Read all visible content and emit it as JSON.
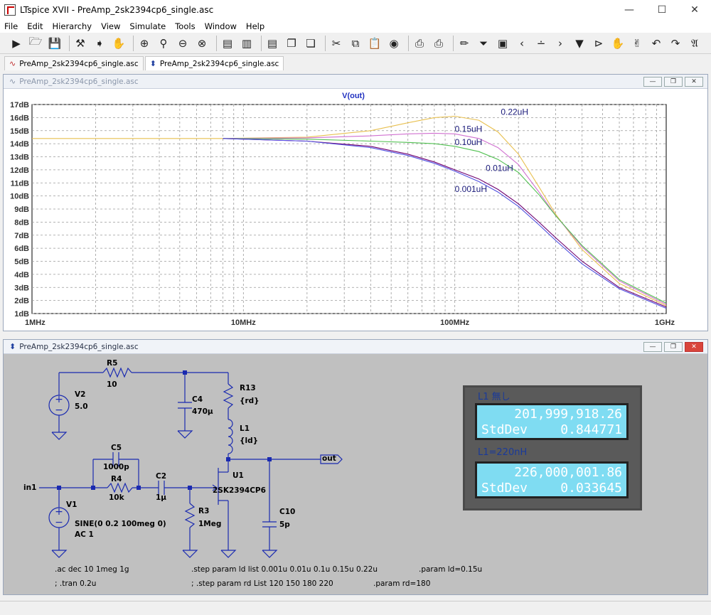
{
  "window": {
    "title": "LTspice XVII - PreAmp_2sk2394cp6_single.asc"
  },
  "menu": [
    "File",
    "Edit",
    "Hierarchy",
    "View",
    "Simulate",
    "Tools",
    "Window",
    "Help"
  ],
  "tabs": [
    {
      "label": "PreAmp_2sk2394cp6_single.asc",
      "icon": "waveform-icon"
    },
    {
      "label": "PreAmp_2sk2394cp6_single.asc",
      "icon": "schematic-icon"
    }
  ],
  "wave_window": {
    "title": "PreAmp_2sk2394cp6_single.asc"
  },
  "schematic_window": {
    "title": "PreAmp_2sk2394cp6_single.asc"
  },
  "chart_data": {
    "type": "line",
    "title": "V(out)",
    "x_scale": "log",
    "xlim": [
      1000000,
      1000000000
    ],
    "x_ticks": [
      "1MHz",
      "10MHz",
      "100MHz",
      "1GHz"
    ],
    "ylim": [
      1,
      17
    ],
    "y_ticks": [
      "1dB",
      "2dB",
      "3dB",
      "4dB",
      "5dB",
      "6dB",
      "7dB",
      "8dB",
      "9dB",
      "10dB",
      "11dB",
      "12dB",
      "13dB",
      "14dB",
      "15dB",
      "16dB",
      "17dB"
    ],
    "grid": true,
    "x": [
      1000000.0,
      8000000.0,
      20000000.0,
      40000000.0,
      60000000.0,
      80000000.0,
      100000000.0,
      130000000.0,
      160000000.0,
      200000000.0,
      250000000.0,
      300000000.0,
      400000000.0,
      600000000.0,
      1000000000.0
    ],
    "series": [
      {
        "name": "0.22uH",
        "color": "#e8c050",
        "values": [
          14.4,
          14.4,
          14.5,
          15.0,
          15.6,
          16.0,
          16.1,
          15.8,
          14.9,
          13.2,
          10.7,
          8.6,
          5.9,
          3.3,
          1.6
        ]
      },
      {
        "name": "0.15uH",
        "color": "#d070d0",
        "values": [
          null,
          14.4,
          14.45,
          14.6,
          14.75,
          14.8,
          14.75,
          14.4,
          13.7,
          12.4,
          10.3,
          8.5,
          6.1,
          3.5,
          1.7
        ]
      },
      {
        "name": "0.10uH",
        "color": "#50c050",
        "values": [
          null,
          14.4,
          14.35,
          14.2,
          14.1,
          14.0,
          13.8,
          13.4,
          12.8,
          11.8,
          10.1,
          8.5,
          6.2,
          3.6,
          1.8
        ]
      },
      {
        "name": "0.01uH",
        "color": "#700070",
        "values": [
          null,
          14.4,
          14.2,
          13.8,
          13.2,
          12.6,
          12.0,
          11.3,
          10.5,
          9.4,
          8.0,
          6.8,
          5.0,
          3.0,
          1.5
        ]
      },
      {
        "name": "0.001uH",
        "color": "#5050e0",
        "values": [
          null,
          14.4,
          14.2,
          13.7,
          13.1,
          12.5,
          11.9,
          11.1,
          10.3,
          9.2,
          7.8,
          6.6,
          4.8,
          2.9,
          1.4
        ]
      }
    ]
  },
  "schematic": {
    "components": [
      {
        "ref": "R5",
        "value": "10"
      },
      {
        "ref": "V2",
        "value": "5.0"
      },
      {
        "ref": "C4",
        "value": "470µ"
      },
      {
        "ref": "R13",
        "value": "{rd}"
      },
      {
        "ref": "L1",
        "value": "{ld}"
      },
      {
        "ref": "C5",
        "value": "1000p"
      },
      {
        "ref": "R4",
        "value": "10k"
      },
      {
        "ref": "C2",
        "value": "1µ"
      },
      {
        "ref": "U1",
        "value": "2SK2394CP6"
      },
      {
        "ref": "R3",
        "value": "1Meg"
      },
      {
        "ref": "C10",
        "value": "5p"
      },
      {
        "ref": "V1",
        "value": "SINE(0 0.2 100meg 0)",
        "value2": "AC 1"
      }
    ],
    "nets": {
      "in": "in1",
      "out": "out"
    },
    "directives": [
      ".ac dec 10 1meg 1g",
      "; .tran 0.2u",
      ".step param ld list 0.001u 0.01u 0.1u  0.15u  0.22u",
      "; .step param rd  List 120 150 180 220",
      ".param ld=0.15u",
      ".param rd=180"
    ]
  },
  "photo": {
    "panel1": {
      "title": "L1 無し",
      "line1": "201,999,918.26",
      "label2": "StdDev",
      "value2": "0.844771"
    },
    "panel2": {
      "title": "L1=220nH",
      "line1": "226,000,001.86",
      "label2": "StdDev",
      "value2": "0.033645"
    }
  }
}
